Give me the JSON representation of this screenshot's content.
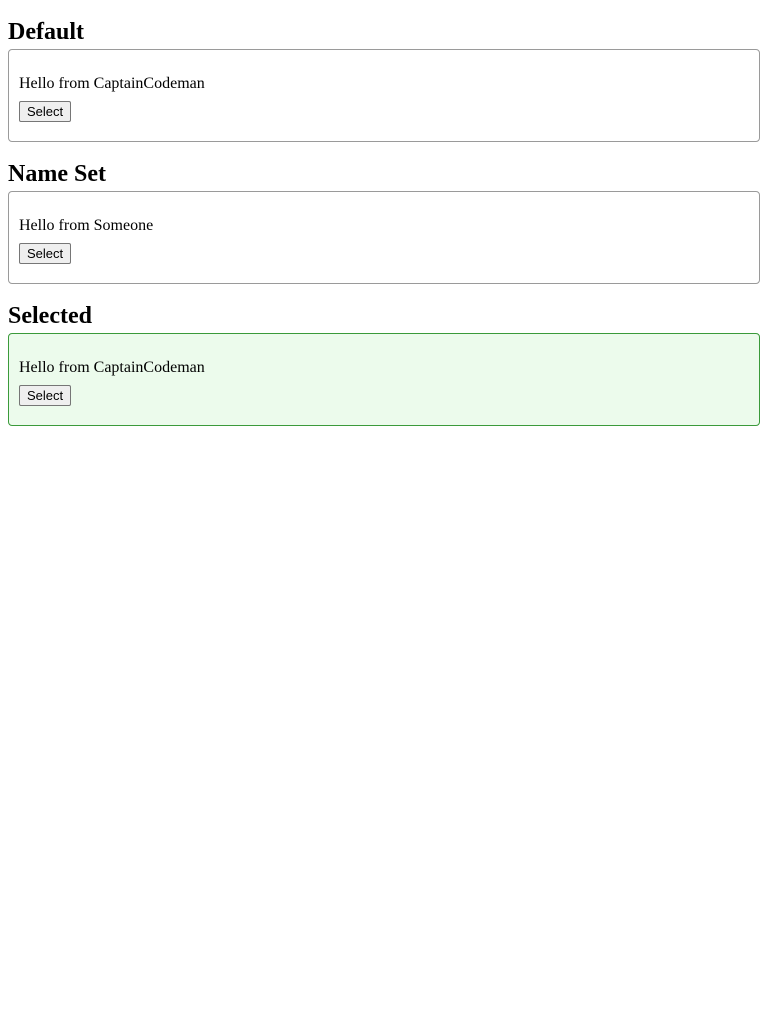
{
  "sections": [
    {
      "title": "Default",
      "greeting": "Hello from CaptainCodeman",
      "button_label": "Select",
      "selected": false
    },
    {
      "title": "Name Set",
      "greeting": "Hello from Someone",
      "button_label": "Select",
      "selected": false
    },
    {
      "title": "Selected",
      "greeting": "Hello from CaptainCodeman",
      "button_label": "Select",
      "selected": true
    }
  ],
  "colors": {
    "selected_border": "#3a9a3a",
    "selected_background": "#ecfbec",
    "default_border": "#9a9a9a"
  }
}
